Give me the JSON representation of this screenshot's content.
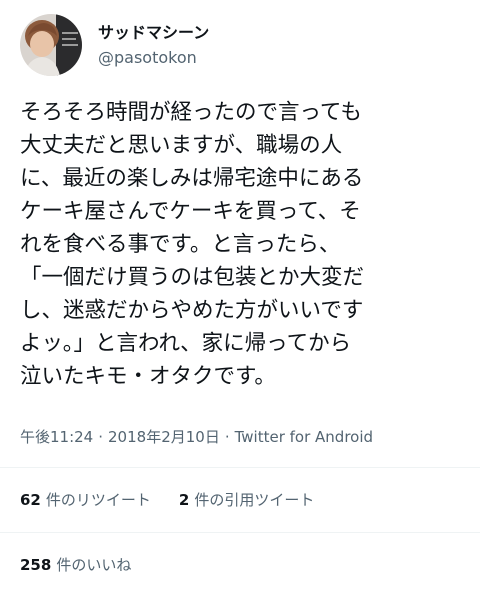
{
  "user": {
    "display_name": "サッドマシーン",
    "handle": "@pasotokon"
  },
  "tweet": {
    "lines": [
      "そろそろ時間が経ったので言っても",
      "大丈夫だと思いますが、職場の人",
      "に、最近の楽しみは帰宅途中にある",
      "ケーキ屋さんでケーキを買って、そ",
      "れを食べる事です。と言ったら、",
      "「一個だけ買うのは包装とか大変だ",
      "し、迷惑だからやめた方がいいです",
      "よッ。」と言われ、家に帰ってから",
      "泣いたキモ・オタクです。"
    ]
  },
  "meta": {
    "time": "午後11:24",
    "separator": "·",
    "date": "2018年2月10日",
    "source": "Twitter for Android"
  },
  "stats": {
    "retweets": {
      "count": "62",
      "label": "件のリツイート"
    },
    "quotes": {
      "count": "2",
      "label": "件の引用ツイート"
    },
    "likes": {
      "count": "258",
      "label": "件のいいね"
    }
  }
}
